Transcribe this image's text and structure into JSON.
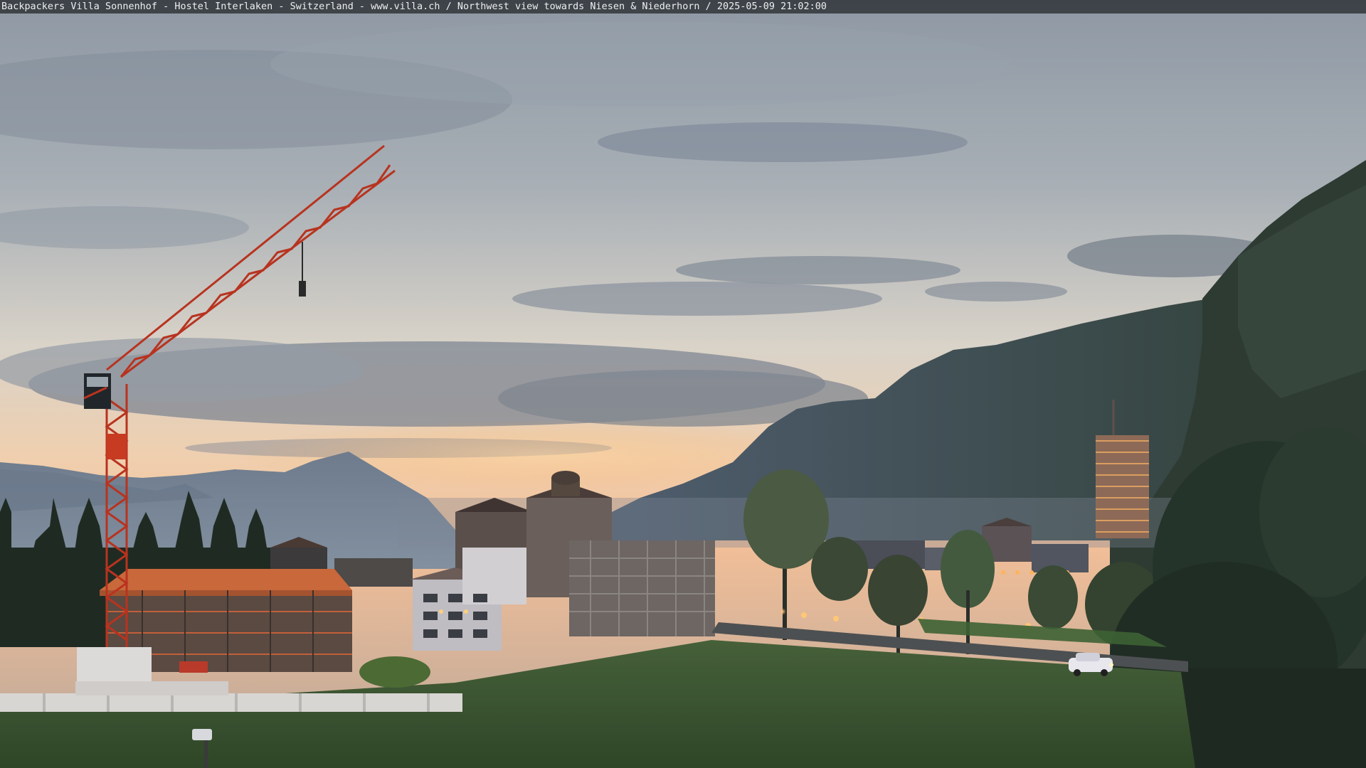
{
  "webcam": {
    "caption": "Backpackers Villa Sonnenhof - Hostel Interlaken - Switzerland - www.villa.ch / Northwest view towards Niesen & Niederhorn / 2025-05-09 21:02:00"
  },
  "scene": {
    "description_colors": {
      "sky_top": "#8f9aa7",
      "sky_horizon": "#f1c9a4",
      "mountain_far": "#6f7d8d",
      "mountain_near": "#2f3d3a",
      "crane": "#b8331f",
      "meadow": "#3e5a32",
      "roof": "#c86a3b"
    },
    "icons": [
      "crane-icon",
      "car-icon",
      "street-lamp-icon"
    ]
  }
}
